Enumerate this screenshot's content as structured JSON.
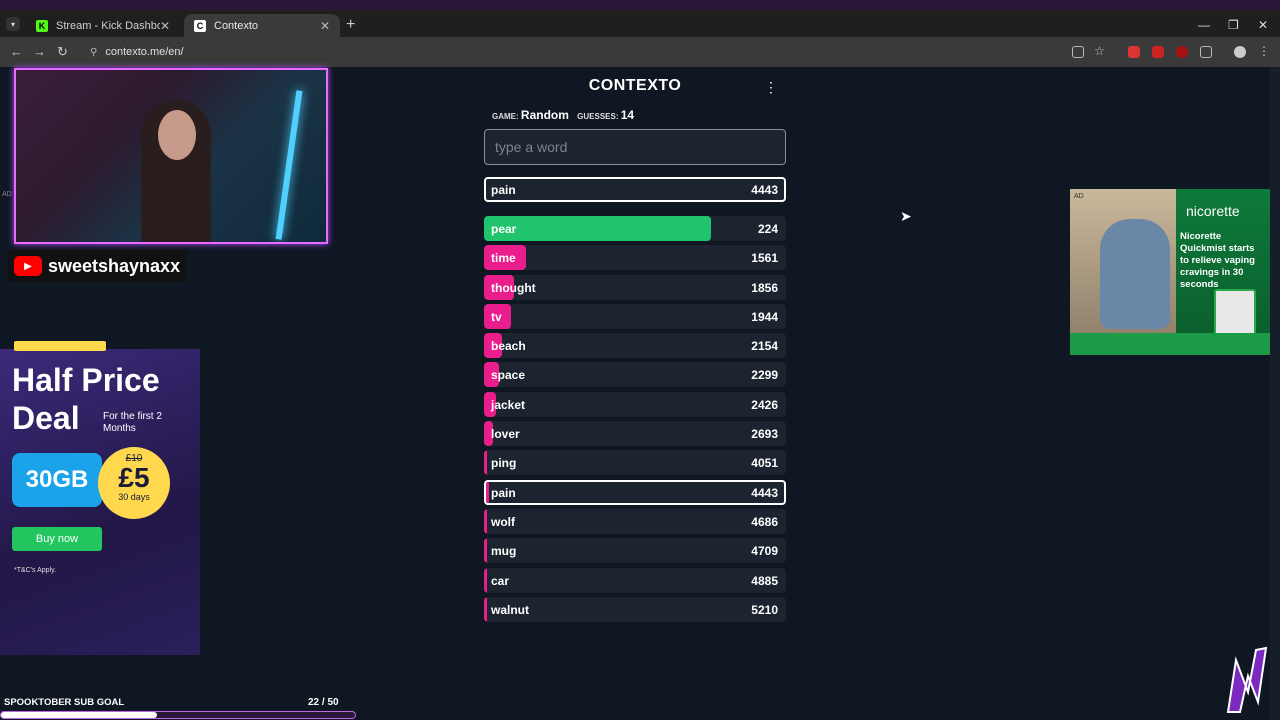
{
  "browser": {
    "tabs": [
      {
        "title": "Stream - Kick Dashboard",
        "active": false
      },
      {
        "title": "Contexto",
        "active": true
      }
    ],
    "url": "contexto.me/en/"
  },
  "app": {
    "title": "CONTEXTO",
    "game_label": "GAME:",
    "game_value": "Random",
    "guesses_label": "GUESSES:",
    "guesses_value": "14",
    "input_placeholder": "type a word",
    "last_guess": {
      "word": "pain",
      "distance": "4443"
    },
    "guesses": [
      {
        "word": "pear",
        "distance": "224",
        "fill": 0.75,
        "color": "#1fc46c",
        "highlight": false
      },
      {
        "word": "time",
        "distance": "1561",
        "fill": 0.14,
        "color": "#ea1d8c",
        "highlight": false
      },
      {
        "word": "thought",
        "distance": "1856",
        "fill": 0.1,
        "color": "#ea1d8c",
        "highlight": false
      },
      {
        "word": "tv",
        "distance": "1944",
        "fill": 0.09,
        "color": "#ea1d8c",
        "highlight": false
      },
      {
        "word": "beach",
        "distance": "2154",
        "fill": 0.06,
        "color": "#ea1d8c",
        "highlight": false
      },
      {
        "word": "space",
        "distance": "2299",
        "fill": 0.05,
        "color": "#ea1d8c",
        "highlight": false
      },
      {
        "word": "jacket",
        "distance": "2426",
        "fill": 0.04,
        "color": "#ea1d8c",
        "highlight": false
      },
      {
        "word": "lover",
        "distance": "2693",
        "fill": 0.03,
        "color": "#ea1d8c",
        "highlight": false
      },
      {
        "word": "ping",
        "distance": "4051",
        "fill": 0.01,
        "color": "#ea1d8c",
        "highlight": false
      },
      {
        "word": "pain",
        "distance": "4443",
        "fill": 0.01,
        "color": "#ea1d8c",
        "highlight": true
      },
      {
        "word": "wolf",
        "distance": "4686",
        "fill": 0.01,
        "color": "#ea1d8c",
        "highlight": false
      },
      {
        "word": "mug",
        "distance": "4709",
        "fill": 0.01,
        "color": "#ea1d8c",
        "highlight": false
      },
      {
        "word": "car",
        "distance": "4885",
        "fill": 0.01,
        "color": "#ea1d8c",
        "highlight": false
      },
      {
        "word": "walnut",
        "distance": "5210",
        "fill": 0.01,
        "color": "#ea1d8c",
        "highlight": false
      }
    ]
  },
  "overlay": {
    "channel": "sweetshaynaxx",
    "sub_goal_label": "SPOOKTOBER SUB GOAL",
    "sub_goal_count": "22",
    "sub_goal_total": "/ 50",
    "sub_goal_progress": 0.44
  },
  "ad_left": {
    "tag": "AD",
    "headline": "Half Price Deal",
    "sub": "For the first 2 Months",
    "data": "30GB",
    "old_price": "£10",
    "new_price": "£5",
    "period": "30 days",
    "cta": "Buy now",
    "terms": "*T&C's Apply."
  },
  "ad_right": {
    "tag": "AD",
    "brand": "nicorette",
    "copy": "Nicorette Quickmist starts to relieve vaping cravings in 30 seconds"
  }
}
